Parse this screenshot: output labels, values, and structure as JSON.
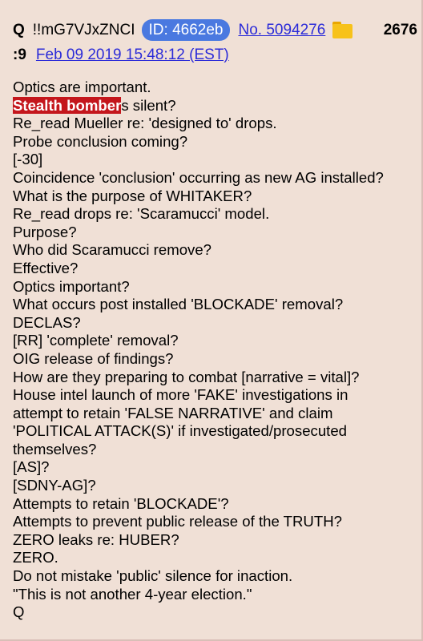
{
  "post": {
    "name": "Q",
    "tripcode": "!!mG7VJxZNCI",
    "id_label": "ID: 4662eb",
    "post_no": "No. 5094276",
    "file_count": "2676",
    "continuation": ":9",
    "datetime": "Feb 09 2019 15:48:12 (EST)"
  },
  "message": {
    "line0": "Optics are important.",
    "highlight": "Stealth bomber",
    "highlight_rest": "s silent?",
    "lines": [
      "Re_read Mueller re: 'designed to' drops.",
      "Probe conclusion coming?",
      "[-30]",
      "Coincidence 'conclusion' occurring as new AG installed?",
      "What is the purpose of WHITAKER?",
      "Re_read drops re: 'Scaramucci' model.",
      "Purpose?",
      "Who did Scaramucci remove?",
      "Effective?",
      "Optics important?",
      "What occurs post installed 'BLOCKADE' removal?",
      "DECLAS?",
      "[RR] 'complete' removal?",
      "OIG release of findings?",
      "How are they preparing to combat [narrative = vital]?",
      "House intel launch of more 'FAKE' investigations in",
      "attempt to retain 'FALSE NARRATIVE' and claim",
      "'POLITICAL ATTACK(S)' if investigated/prosecuted",
      "themselves?",
      "[AS]?",
      "[SDNY-AG]?",
      "Attempts to retain 'BLOCKADE'?",
      "Attempts to prevent public release of the TRUTH?",
      "ZERO leaks re: HUBER?",
      "ZERO.",
      "Do not mistake 'public' silence for inaction.",
      "\"This is not another 4-year election.\"",
      "Q"
    ]
  },
  "colors": {
    "background": "#f0e0d6",
    "id_badge": "#4a79e0",
    "link": "#2b2bd8",
    "highlight": "#c4161c"
  },
  "icons": {
    "folder": "folder-icon"
  }
}
